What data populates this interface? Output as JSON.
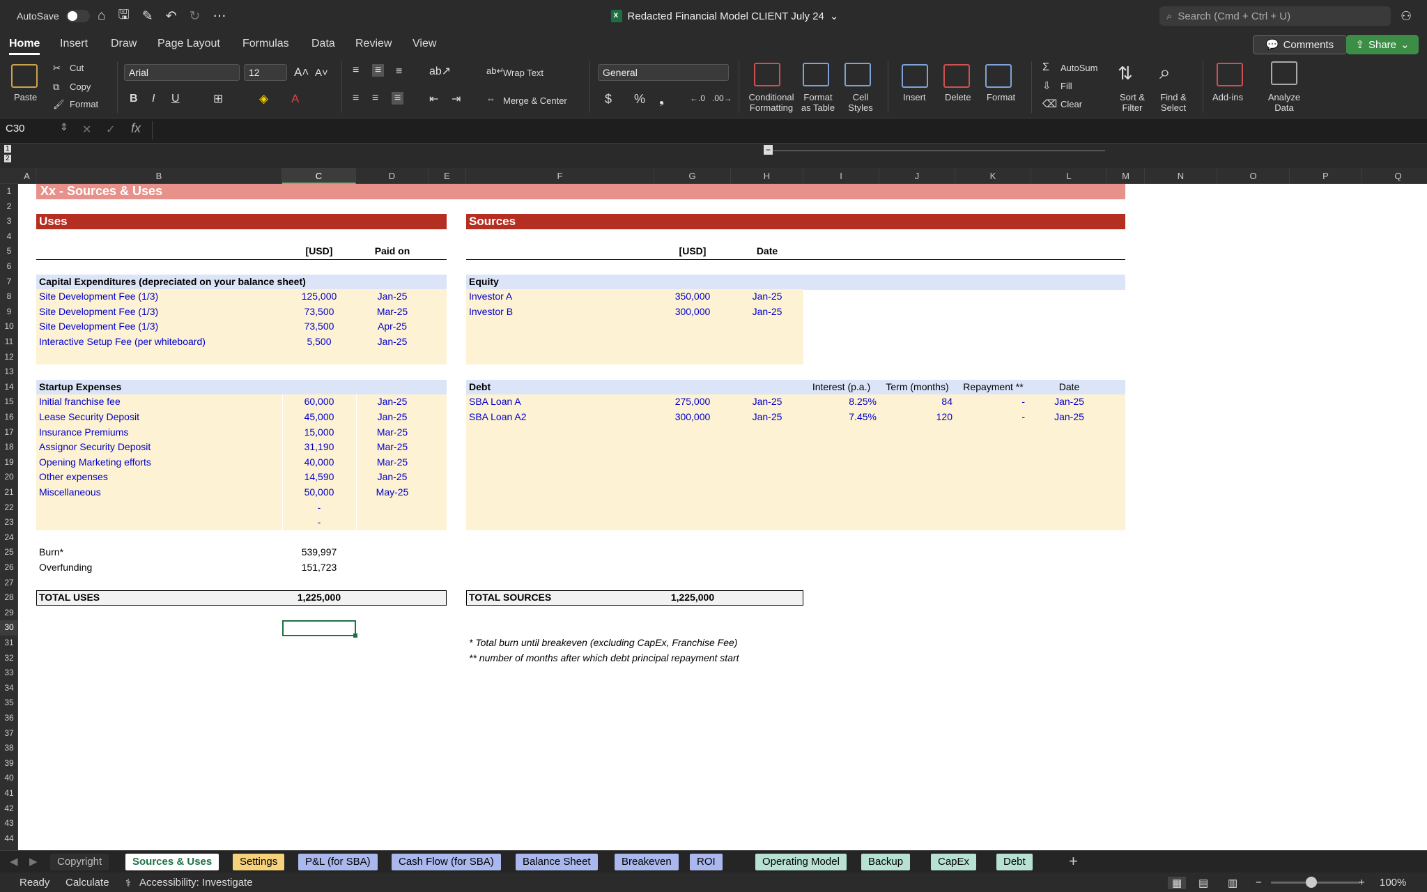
{
  "titlebar": {
    "autosave": "AutoSave",
    "doc_title": "Redacted Financial Model CLIENT July 24",
    "search_placeholder": "Search (Cmd + Ctrl + U)"
  },
  "ribbon_tabs": [
    "Home",
    "Insert",
    "Draw",
    "Page Layout",
    "Formulas",
    "Data",
    "Review",
    "View"
  ],
  "comments_label": "Comments",
  "share_label": "Share",
  "ribbon": {
    "paste": "Paste",
    "cut": "Cut",
    "copy": "Copy",
    "format": "Format",
    "font_name": "Arial",
    "font_size": "12",
    "wrap_text": "Wrap Text",
    "merge_center": "Merge & Center",
    "number_format": "General",
    "conditional_formatting": "Conditional Formatting",
    "format_as_table": "Format as Table",
    "cell_styles": "Cell Styles",
    "insert": "Insert",
    "delete": "Delete",
    "format_cells": "Format",
    "autosum": "AutoSum",
    "fill": "Fill",
    "clear": "Clear",
    "sort_filter": "Sort & Filter",
    "find_select": "Find & Select",
    "addins": "Add-ins",
    "analyze_data": "Analyze Data"
  },
  "formula_bar": {
    "name_box": "C30",
    "fx": "fx"
  },
  "columns": [
    "A",
    "B",
    "C",
    "D",
    "E",
    "F",
    "G",
    "H",
    "I",
    "J",
    "K",
    "L",
    "M",
    "N",
    "O",
    "P",
    "Q"
  ],
  "sheet": {
    "title": "Xx - Sources & Uses",
    "uses_header": "Uses",
    "sources_header": "Sources",
    "usd": "[USD]",
    "paid_on": "Paid on",
    "date": "Date",
    "capex_header": "Capital Expenditures (depreciated on your balance sheet)",
    "capex_rows": [
      {
        "label": "Site Development Fee (1/3)",
        "value": "125,000",
        "date": "Jan-25"
      },
      {
        "label": "Site Development Fee (1/3)",
        "value": "73,500",
        "date": "Mar-25"
      },
      {
        "label": "Site Development Fee (1/3)",
        "value": "73,500",
        "date": "Apr-25"
      },
      {
        "label": "Interactive Setup Fee (per whiteboard)",
        "value": "5,500",
        "date": "Jan-25"
      }
    ],
    "startup_header": "Startup Expenses",
    "startup_rows": [
      {
        "label": "Initial franchise fee",
        "value": "60,000",
        "date": "Jan-25"
      },
      {
        "label": "Lease Security Deposit",
        "value": "45,000",
        "date": "Jan-25"
      },
      {
        "label": "Insurance Premiums",
        "value": "15,000",
        "date": "Mar-25"
      },
      {
        "label": "Assignor Security Deposit",
        "value": "31,190",
        "date": "Mar-25"
      },
      {
        "label": "Opening Marketing efforts",
        "value": "40,000",
        "date": "Mar-25"
      },
      {
        "label": "Other expenses",
        "value": "14,590",
        "date": "Jan-25"
      },
      {
        "label": "Miscellaneous",
        "value": "50,000",
        "date": "May-25"
      },
      {
        "label": "",
        "value": "-",
        "date": ""
      },
      {
        "label": "",
        "value": "-",
        "date": ""
      }
    ],
    "burn_label": "Burn*",
    "burn_value": "539,997",
    "overfunding_label": "Overfunding",
    "overfunding_value": "151,723",
    "total_uses_label": "TOTAL USES",
    "total_uses_value": "1,225,000",
    "equity_header": "Equity",
    "equity_rows": [
      {
        "label": "Investor A",
        "value": "350,000",
        "date": "Jan-25"
      },
      {
        "label": "Investor B",
        "value": "300,000",
        "date": "Jan-25"
      }
    ],
    "debt_header": "Debt",
    "debt_cols": {
      "interest": "Interest (p.a.)",
      "term": "Term (months)",
      "repayment": "Repayment **",
      "date": "Date"
    },
    "debt_rows": [
      {
        "label": "SBA Loan A",
        "value": "275,000",
        "date": "Jan-25",
        "interest": "8.25%",
        "term": "84",
        "repayment": "-",
        "date2": "Jan-25"
      },
      {
        "label": "SBA Loan A2",
        "value": "300,000",
        "date": "Jan-25",
        "interest": "7.45%",
        "term": "120",
        "repayment": "-",
        "date2": "Jan-25"
      }
    ],
    "total_sources_label": "TOTAL SOURCES",
    "total_sources_value": "1,225,000",
    "note1": "* Total burn until breakeven (excluding CapEx, Franchise Fee)",
    "note2": "** number of months after which debt principal repayment start"
  },
  "sheet_tabs": [
    {
      "label": "Copyright",
      "color": "#2f2f2f"
    },
    {
      "label": "Sources & Uses",
      "color": "#ffffff"
    },
    {
      "label": "Settings",
      "color": "#f6d27a"
    },
    {
      "label": "P&L (for SBA)",
      "color": "#aab8ee"
    },
    {
      "label": "Cash Flow (for SBA)",
      "color": "#aab8ee"
    },
    {
      "label": "Balance Sheet",
      "color": "#aab8ee"
    },
    {
      "label": "Breakeven",
      "color": "#aab8ee"
    },
    {
      "label": "ROI",
      "color": "#aab8ee"
    },
    {
      "label": "Operating Model",
      "color": "#b7e2d3"
    },
    {
      "label": "Backup",
      "color": "#b7e2d3"
    },
    {
      "label": "CapEx",
      "color": "#b7e2d3"
    },
    {
      "label": "Debt",
      "color": "#b7e2d3"
    }
  ],
  "statusbar": {
    "ready": "Ready",
    "calculate": "Calculate",
    "accessibility": "Accessibility: Investigate",
    "zoom": "100%"
  },
  "colors": {
    "title_band": "#e8918a",
    "header_band": "#b52e22",
    "section_band": "#dbe5f7",
    "input_band": "#fdf2d3",
    "input_text": "#0000cc"
  }
}
